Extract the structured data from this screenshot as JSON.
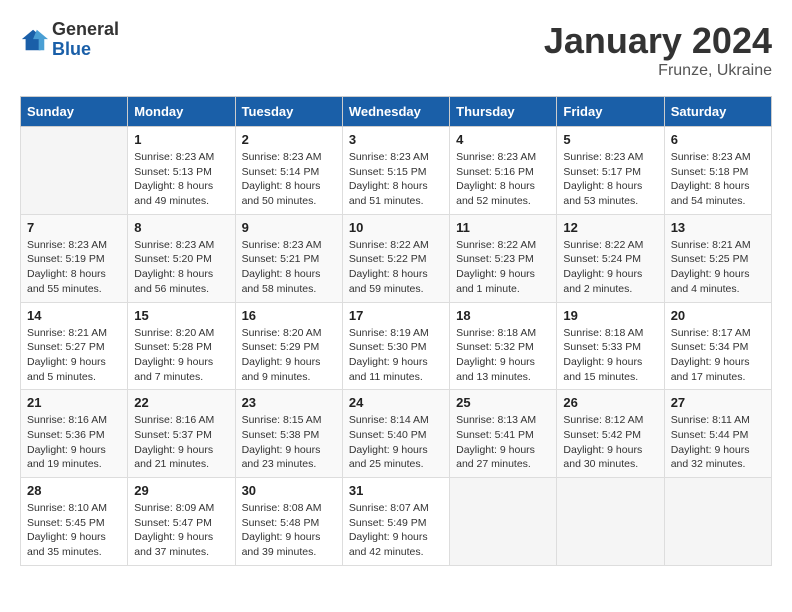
{
  "header": {
    "logo_general": "General",
    "logo_blue": "Blue",
    "month_year": "January 2024",
    "location": "Frunze, Ukraine"
  },
  "days_of_week": [
    "Sunday",
    "Monday",
    "Tuesday",
    "Wednesday",
    "Thursday",
    "Friday",
    "Saturday"
  ],
  "weeks": [
    [
      {
        "day": "",
        "sunrise": "",
        "sunset": "",
        "daylight": ""
      },
      {
        "day": "1",
        "sunrise": "Sunrise: 8:23 AM",
        "sunset": "Sunset: 5:13 PM",
        "daylight": "Daylight: 8 hours and 49 minutes."
      },
      {
        "day": "2",
        "sunrise": "Sunrise: 8:23 AM",
        "sunset": "Sunset: 5:14 PM",
        "daylight": "Daylight: 8 hours and 50 minutes."
      },
      {
        "day": "3",
        "sunrise": "Sunrise: 8:23 AM",
        "sunset": "Sunset: 5:15 PM",
        "daylight": "Daylight: 8 hours and 51 minutes."
      },
      {
        "day": "4",
        "sunrise": "Sunrise: 8:23 AM",
        "sunset": "Sunset: 5:16 PM",
        "daylight": "Daylight: 8 hours and 52 minutes."
      },
      {
        "day": "5",
        "sunrise": "Sunrise: 8:23 AM",
        "sunset": "Sunset: 5:17 PM",
        "daylight": "Daylight: 8 hours and 53 minutes."
      },
      {
        "day": "6",
        "sunrise": "Sunrise: 8:23 AM",
        "sunset": "Sunset: 5:18 PM",
        "daylight": "Daylight: 8 hours and 54 minutes."
      }
    ],
    [
      {
        "day": "7",
        "sunrise": "Sunrise: 8:23 AM",
        "sunset": "Sunset: 5:19 PM",
        "daylight": "Daylight: 8 hours and 55 minutes."
      },
      {
        "day": "8",
        "sunrise": "Sunrise: 8:23 AM",
        "sunset": "Sunset: 5:20 PM",
        "daylight": "Daylight: 8 hours and 56 minutes."
      },
      {
        "day": "9",
        "sunrise": "Sunrise: 8:23 AM",
        "sunset": "Sunset: 5:21 PM",
        "daylight": "Daylight: 8 hours and 58 minutes."
      },
      {
        "day": "10",
        "sunrise": "Sunrise: 8:22 AM",
        "sunset": "Sunset: 5:22 PM",
        "daylight": "Daylight: 8 hours and 59 minutes."
      },
      {
        "day": "11",
        "sunrise": "Sunrise: 8:22 AM",
        "sunset": "Sunset: 5:23 PM",
        "daylight": "Daylight: 9 hours and 1 minute."
      },
      {
        "day": "12",
        "sunrise": "Sunrise: 8:22 AM",
        "sunset": "Sunset: 5:24 PM",
        "daylight": "Daylight: 9 hours and 2 minutes."
      },
      {
        "day": "13",
        "sunrise": "Sunrise: 8:21 AM",
        "sunset": "Sunset: 5:25 PM",
        "daylight": "Daylight: 9 hours and 4 minutes."
      }
    ],
    [
      {
        "day": "14",
        "sunrise": "Sunrise: 8:21 AM",
        "sunset": "Sunset: 5:27 PM",
        "daylight": "Daylight: 9 hours and 5 minutes."
      },
      {
        "day": "15",
        "sunrise": "Sunrise: 8:20 AM",
        "sunset": "Sunset: 5:28 PM",
        "daylight": "Daylight: 9 hours and 7 minutes."
      },
      {
        "day": "16",
        "sunrise": "Sunrise: 8:20 AM",
        "sunset": "Sunset: 5:29 PM",
        "daylight": "Daylight: 9 hours and 9 minutes."
      },
      {
        "day": "17",
        "sunrise": "Sunrise: 8:19 AM",
        "sunset": "Sunset: 5:30 PM",
        "daylight": "Daylight: 9 hours and 11 minutes."
      },
      {
        "day": "18",
        "sunrise": "Sunrise: 8:18 AM",
        "sunset": "Sunset: 5:32 PM",
        "daylight": "Daylight: 9 hours and 13 minutes."
      },
      {
        "day": "19",
        "sunrise": "Sunrise: 8:18 AM",
        "sunset": "Sunset: 5:33 PM",
        "daylight": "Daylight: 9 hours and 15 minutes."
      },
      {
        "day": "20",
        "sunrise": "Sunrise: 8:17 AM",
        "sunset": "Sunset: 5:34 PM",
        "daylight": "Daylight: 9 hours and 17 minutes."
      }
    ],
    [
      {
        "day": "21",
        "sunrise": "Sunrise: 8:16 AM",
        "sunset": "Sunset: 5:36 PM",
        "daylight": "Daylight: 9 hours and 19 minutes."
      },
      {
        "day": "22",
        "sunrise": "Sunrise: 8:16 AM",
        "sunset": "Sunset: 5:37 PM",
        "daylight": "Daylight: 9 hours and 21 minutes."
      },
      {
        "day": "23",
        "sunrise": "Sunrise: 8:15 AM",
        "sunset": "Sunset: 5:38 PM",
        "daylight": "Daylight: 9 hours and 23 minutes."
      },
      {
        "day": "24",
        "sunrise": "Sunrise: 8:14 AM",
        "sunset": "Sunset: 5:40 PM",
        "daylight": "Daylight: 9 hours and 25 minutes."
      },
      {
        "day": "25",
        "sunrise": "Sunrise: 8:13 AM",
        "sunset": "Sunset: 5:41 PM",
        "daylight": "Daylight: 9 hours and 27 minutes."
      },
      {
        "day": "26",
        "sunrise": "Sunrise: 8:12 AM",
        "sunset": "Sunset: 5:42 PM",
        "daylight": "Daylight: 9 hours and 30 minutes."
      },
      {
        "day": "27",
        "sunrise": "Sunrise: 8:11 AM",
        "sunset": "Sunset: 5:44 PM",
        "daylight": "Daylight: 9 hours and 32 minutes."
      }
    ],
    [
      {
        "day": "28",
        "sunrise": "Sunrise: 8:10 AM",
        "sunset": "Sunset: 5:45 PM",
        "daylight": "Daylight: 9 hours and 35 minutes."
      },
      {
        "day": "29",
        "sunrise": "Sunrise: 8:09 AM",
        "sunset": "Sunset: 5:47 PM",
        "daylight": "Daylight: 9 hours and 37 minutes."
      },
      {
        "day": "30",
        "sunrise": "Sunrise: 8:08 AM",
        "sunset": "Sunset: 5:48 PM",
        "daylight": "Daylight: 9 hours and 39 minutes."
      },
      {
        "day": "31",
        "sunrise": "Sunrise: 8:07 AM",
        "sunset": "Sunset: 5:49 PM",
        "daylight": "Daylight: 9 hours and 42 minutes."
      },
      {
        "day": "",
        "sunrise": "",
        "sunset": "",
        "daylight": ""
      },
      {
        "day": "",
        "sunrise": "",
        "sunset": "",
        "daylight": ""
      },
      {
        "day": "",
        "sunrise": "",
        "sunset": "",
        "daylight": ""
      }
    ]
  ]
}
